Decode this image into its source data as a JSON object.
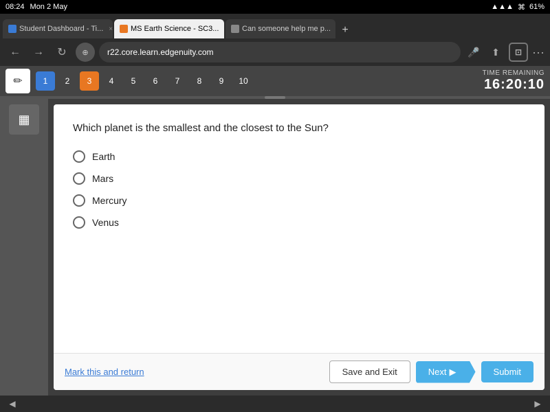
{
  "status_bar": {
    "time": "08:24",
    "day": "Mon 2 May",
    "signal": "●●●",
    "wifi": "wifi",
    "battery": "61%"
  },
  "tabs": [
    {
      "id": 1,
      "label": "Student Dashboard - Ti...",
      "active": false,
      "favicon_color": "blue"
    },
    {
      "id": 2,
      "label": "MS Earth Science - SC3...",
      "active": true,
      "favicon_color": "orange"
    },
    {
      "id": 3,
      "label": "Can someone help me p...",
      "active": false,
      "favicon_color": "gray"
    }
  ],
  "address_bar": {
    "url": "r22.core.learn.edgenuity.com"
  },
  "toolbar": {
    "pencil_label": "✏",
    "calculator_label": "⊞",
    "question_numbers": [
      "1",
      "2",
      "3",
      "4",
      "5",
      "6",
      "7",
      "8",
      "9",
      "10"
    ],
    "current_question": "1",
    "highlighted_question": "3",
    "time_remaining_label": "TIME REMAINING",
    "time_remaining_value": "16:20:10"
  },
  "question": {
    "text": "Which planet is the smallest and the closest to the Sun?",
    "options": [
      {
        "id": "earth",
        "label": "Earth"
      },
      {
        "id": "mars",
        "label": "Mars"
      },
      {
        "id": "mercury",
        "label": "Mercury"
      },
      {
        "id": "venus",
        "label": "Venus"
      }
    ],
    "selected": null
  },
  "footer": {
    "mark_return_label": "Mark this and return",
    "save_exit_label": "Save and Exit",
    "next_label": "Next",
    "submit_label": "Submit"
  }
}
